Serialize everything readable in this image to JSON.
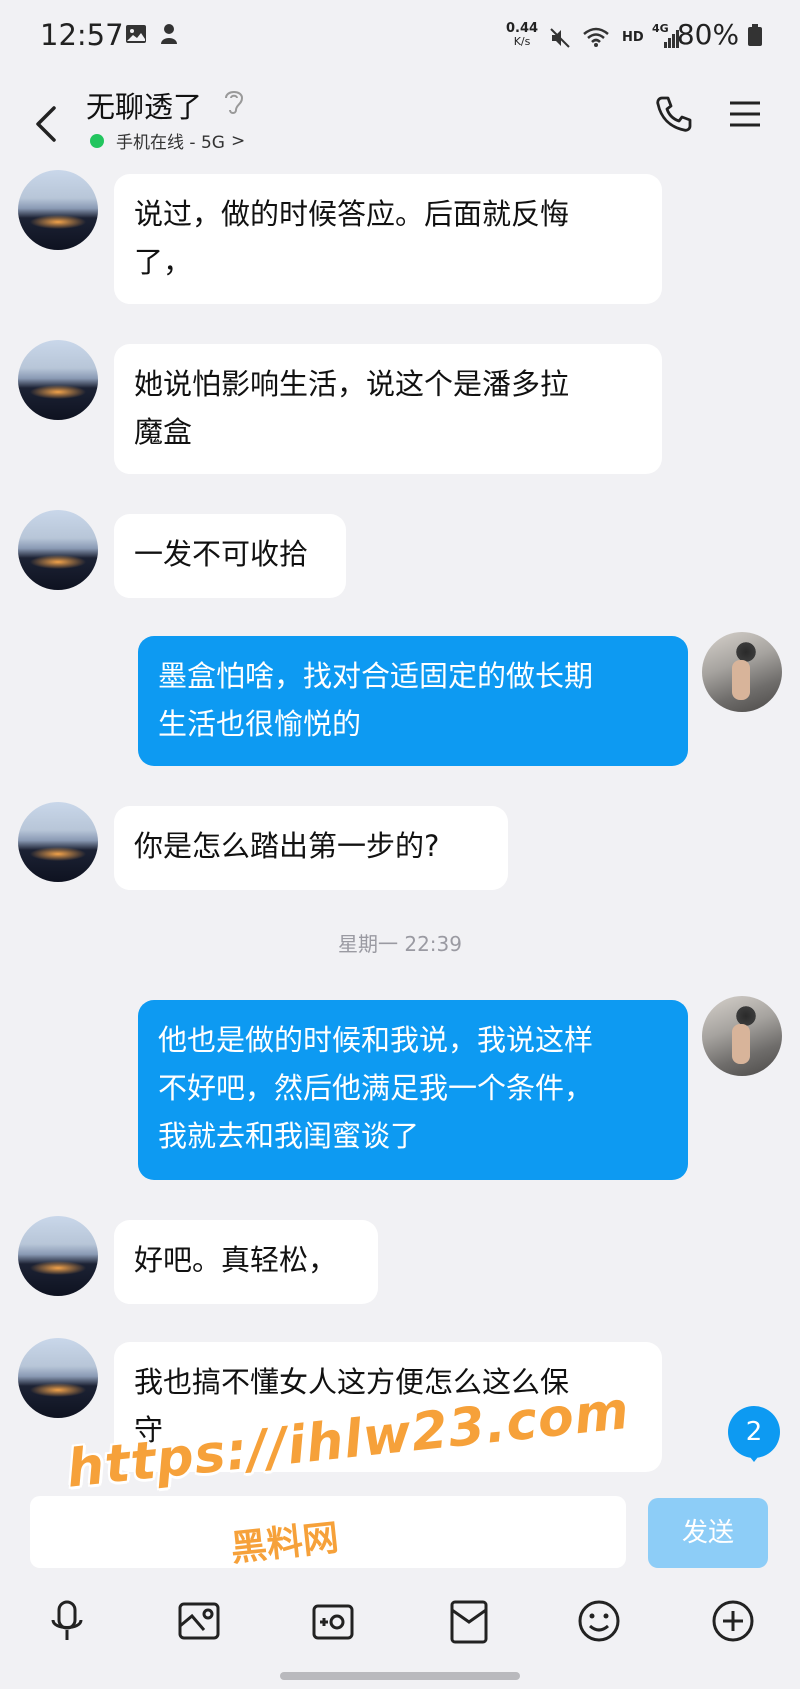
{
  "status_bar": {
    "time": "12:57",
    "net_speed_value": "0.44",
    "net_speed_unit": "K/s",
    "hd": "HD",
    "signal_type": "4G",
    "battery": "80%"
  },
  "header": {
    "contact_name": "无聊透了",
    "online_status": "手机在线 - 5G",
    "online_chevron": ">"
  },
  "messages": [
    {
      "direction": "in",
      "lines": [
        "说过，做的时候答应。后面就反悔",
        "了，"
      ]
    },
    {
      "direction": "in",
      "lines": [
        "她说怕影响生活，说这个是潘多拉",
        "魔盒"
      ]
    },
    {
      "direction": "in",
      "lines": [
        "一发不可收拾"
      ]
    },
    {
      "direction": "out",
      "lines": [
        "墨盒怕啥，找对合适固定的做长期",
        "生活也很愉悦的"
      ]
    },
    {
      "direction": "in",
      "lines": [
        "你是怎么踏出第一步的?"
      ]
    },
    {
      "direction": "out",
      "lines": [
        "他也是做的时候和我说，我说这样",
        "不好吧，然后他满足我一个条件，",
        "我就去和我闺蜜谈了"
      ]
    },
    {
      "direction": "in",
      "lines": [
        "好吧。真轻松，"
      ]
    },
    {
      "direction": "in",
      "lines": [
        "我也搞不懂女人这方便怎么这么保",
        "守"
      ]
    }
  ],
  "timestamp": "星期一 22:39",
  "unread_badge": "2",
  "input": {
    "placeholder": "",
    "send_label": "发送"
  },
  "toolbar": {
    "items": [
      "microphone-icon",
      "image-icon",
      "camera-icon",
      "red-packet-icon",
      "emoji-icon",
      "plus-icon"
    ]
  },
  "watermark": {
    "url": "https://ihlw23.com",
    "site_name": "黑料网"
  },
  "colors": {
    "background": "#f1f1f4",
    "outgoing_bubble": "#0d9af2",
    "incoming_bubble": "#ffffff",
    "online_dot": "#22c55e",
    "send_button": "#8dcdf7",
    "watermark": "#f6a13a"
  }
}
